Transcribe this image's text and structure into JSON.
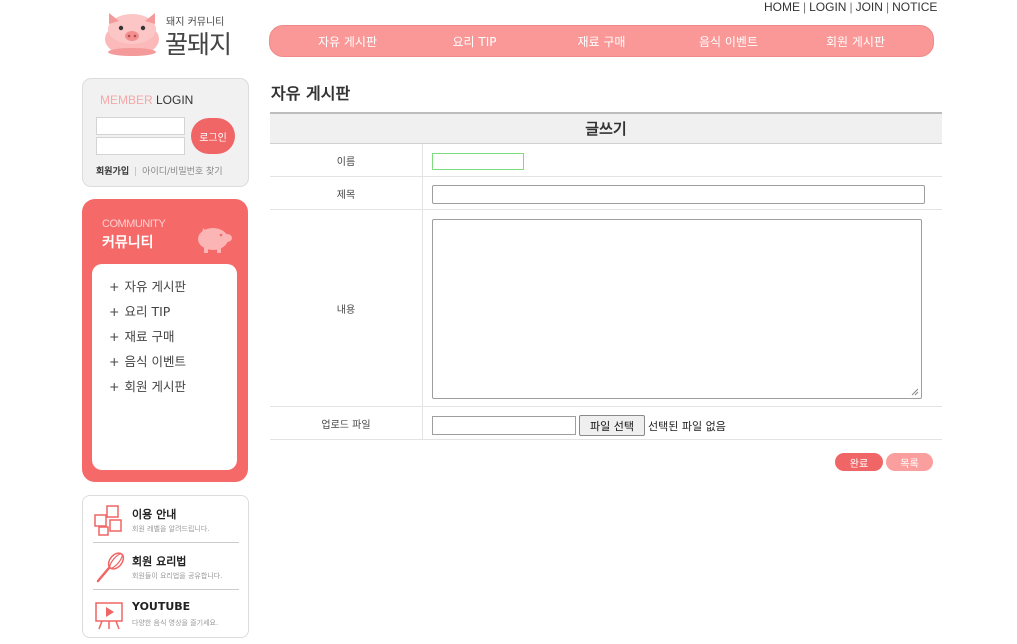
{
  "top_links": [
    "HOME",
    "LOGIN",
    "JOIN",
    "NOTICE"
  ],
  "logo": {
    "subtitle": "돼지 커뮤니티",
    "name": "꿀돼지"
  },
  "nav": [
    "자유 게시판",
    "요리 TIP",
    "재료 구매",
    "음식 이벤트",
    "회원 게시판"
  ],
  "login": {
    "title_a": "MEMBER",
    "title_b": " LOGIN",
    "button": "로그인",
    "join": "회원가입",
    "find": "아이디/비밀번호 찾기"
  },
  "community": {
    "title_en": "COMMUNITY",
    "title_ko": "커뮤니티",
    "items": [
      "자유 게시판",
      "요리 TIP",
      "재료 구매",
      "음식 이벤트",
      "회원 게시판"
    ]
  },
  "info": [
    {
      "title": "이용 안내",
      "desc": "회원 레벨을 알려드립니다.",
      "icon": "squares-icon"
    },
    {
      "title": "회원 요리법",
      "desc": "회원들이 요리법을 공유합니다.",
      "icon": "whisk-icon"
    },
    {
      "title": "YOUTUBE",
      "desc": "다양한 음식 영상을 즐기세요.",
      "icon": "video-board-icon"
    }
  ],
  "page_title": "자유 게시판",
  "form": {
    "heading": "글쓰기",
    "name_label": "이름",
    "subject_label": "제목",
    "content_label": "내용",
    "file_label": "업로드 파일",
    "file_button": "파일 선택",
    "file_status": "선택된 파일 없음"
  },
  "buttons": {
    "done": "완료",
    "list": "목록"
  },
  "colors": {
    "primary": "#f06565",
    "nav": "#fa9797",
    "light_pink": "#fb9e9e"
  }
}
